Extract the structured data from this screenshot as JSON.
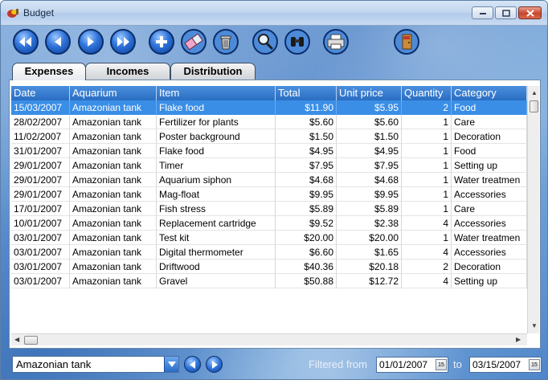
{
  "window": {
    "title": "Budget"
  },
  "tabs": [
    {
      "label": "Expenses"
    },
    {
      "label": "Incomes"
    },
    {
      "label": "Distribution"
    }
  ],
  "grid": {
    "columns": [
      "Date",
      "Aquarium",
      "Item",
      "Total",
      "Unit price",
      "Quantity",
      "Category"
    ],
    "rows": [
      [
        "15/03/2007",
        "Amazonian tank",
        "Flake food",
        "$11.90",
        "$5.95",
        "2",
        "Food"
      ],
      [
        "28/02/2007",
        "Amazonian tank",
        "Fertilizer for plants",
        "$5.60",
        "$5.60",
        "1",
        "Care"
      ],
      [
        "11/02/2007",
        "Amazonian tank",
        "Poster background",
        "$1.50",
        "$1.50",
        "1",
        "Decoration"
      ],
      [
        "31/01/2007",
        "Amazonian tank",
        "Flake food",
        "$4.95",
        "$4.95",
        "1",
        "Food"
      ],
      [
        "29/01/2007",
        "Amazonian tank",
        "Timer",
        "$7.95",
        "$7.95",
        "1",
        "Setting up"
      ],
      [
        "29/01/2007",
        "Amazonian tank",
        "Aquarium siphon",
        "$4.68",
        "$4.68",
        "1",
        "Water treatmen"
      ],
      [
        "29/01/2007",
        "Amazonian tank",
        "Mag-float",
        "$9.95",
        "$9.95",
        "1",
        "Accessories"
      ],
      [
        "17/01/2007",
        "Amazonian tank",
        "Fish stress",
        "$5.89",
        "$5.89",
        "1",
        "Care"
      ],
      [
        "10/01/2007",
        "Amazonian tank",
        "Replacement cartridge",
        "$9.52",
        "$2.38",
        "4",
        "Accessories"
      ],
      [
        "03/01/2007",
        "Amazonian tank",
        "Test kit",
        "$20.00",
        "$20.00",
        "1",
        "Water treatmen"
      ],
      [
        "03/01/2007",
        "Amazonian tank",
        "Digital thermometer",
        "$6.60",
        "$1.65",
        "4",
        "Accessories"
      ],
      [
        "03/01/2007",
        "Amazonian tank",
        "Driftwood",
        "$40.36",
        "$20.18",
        "2",
        "Decoration"
      ],
      [
        "03/01/2007",
        "Amazonian tank",
        "Gravel",
        "$50.88",
        "$12.72",
        "4",
        "Setting up"
      ]
    ]
  },
  "filter": {
    "aquarium": "Amazonian tank",
    "from_label": "Filtered from",
    "from_date": "01/01/2007",
    "to_label": "to",
    "to_date": "03/15/2007",
    "calendar_glyph": "15"
  },
  "colors": {
    "selection": "#3a8ee6",
    "header": "#2a6dc3"
  }
}
